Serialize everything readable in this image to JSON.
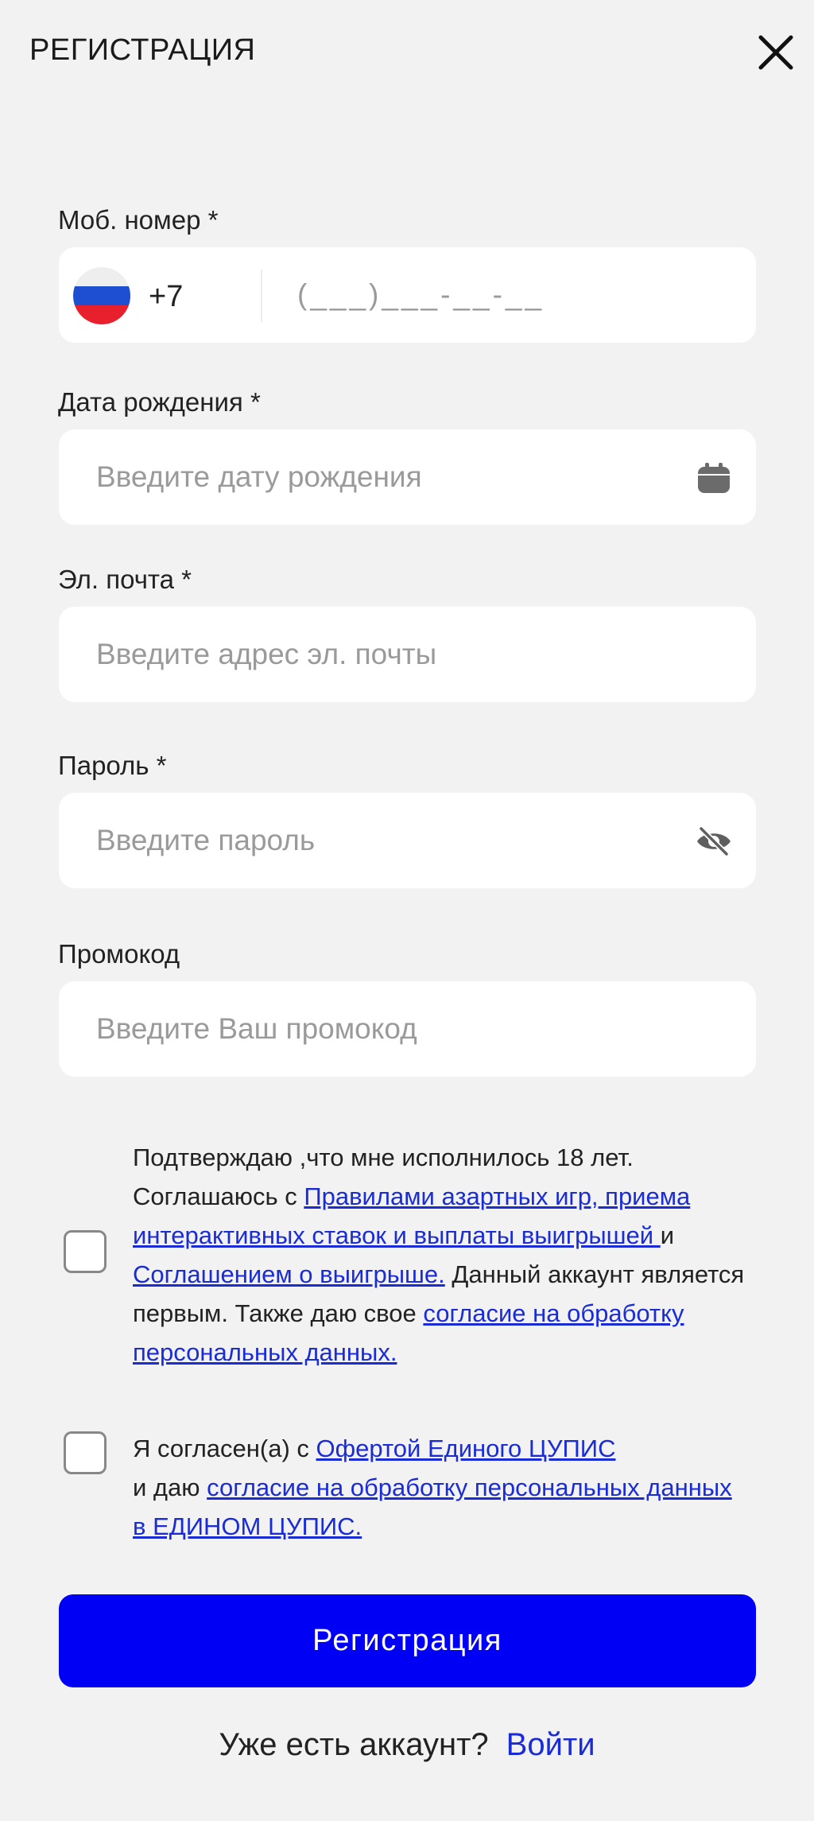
{
  "header": {
    "title": "РЕГИСТРАЦИЯ"
  },
  "phone": {
    "label": "Моб. номер *",
    "code": "+7",
    "placeholder": "(___)___-__-__",
    "flag_colors": [
      "#eeeeee",
      "#1f4fd1",
      "#e8202d"
    ]
  },
  "birthdate": {
    "label": "Дата рождения *",
    "placeholder": "Введите дату рождения",
    "icon": "calendar-icon"
  },
  "email": {
    "label": "Эл. почта *",
    "placeholder": "Введите адрес эл. почты"
  },
  "password": {
    "label": "Пароль *",
    "placeholder": "Введите пароль",
    "icon": "eye-off-icon"
  },
  "promo": {
    "label": "Промокод",
    "placeholder": "Введите Ваш промокод"
  },
  "agreement1": {
    "checked": false,
    "t1": "Подтверждаю ,что мне исполнилось 18 лет. Соглашаюсь с ",
    "link1": "Правилами азартных игр, приема интерактивных ставок и выплаты выигрышей ",
    "t2": "и ",
    "link2": "Соглашением о выигрыше.",
    "t3": " Данный аккаунт является первым. Также даю свое ",
    "link3": "согласие на обработку персональных данных."
  },
  "agreement2": {
    "checked": false,
    "t1": "Я согласен(а) с ",
    "link1": "Офертой Единого ЦУПИС",
    "t2": "и даю ",
    "link2": "согласие на обработку персональных данных в ЕДИНОМ ЦУПИС."
  },
  "submit": {
    "label": "Регистрация"
  },
  "login": {
    "question": "Уже есть аккаунт?",
    "link": "Войти"
  },
  "colors": {
    "accent": "#0000f5",
    "link": "#1a2cd6",
    "background": "#f2f2f2"
  }
}
